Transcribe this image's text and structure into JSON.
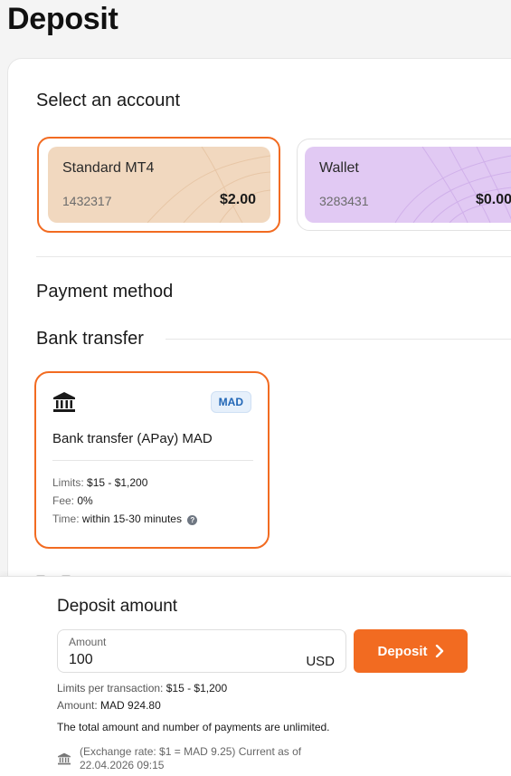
{
  "page": {
    "title": "Deposit"
  },
  "accounts_section": {
    "title": "Select an account",
    "accounts": [
      {
        "name": "Standard MT4",
        "number": "1432317",
        "balance": "$2.00",
        "selected": true,
        "color": "#f1d8bf"
      },
      {
        "name": "Wallet",
        "number": "3283431",
        "balance": "$0.00",
        "selected": false,
        "color": "#e1c9f3"
      }
    ]
  },
  "payment": {
    "title": "Payment method",
    "group_title": "Bank transfer",
    "method": {
      "icon": "bank-icon",
      "currency": "MAD",
      "name": "Bank transfer (APay) MAD",
      "limits_label": "Limits:",
      "limits_value": "$15 - $1,200",
      "fee_label": "Fee:",
      "fee_value": "0%",
      "time_label": "Time:",
      "time_value": "within 15-30 minutes"
    }
  },
  "deposit_amount": {
    "title": "Deposit amount",
    "field_label": "Amount",
    "value": "100",
    "currency": "USD",
    "button_label": "Deposit",
    "limits_label": "Limits per transaction:",
    "limits_value": "$15 - $1,200",
    "amount_label": "Amount:",
    "amount_value": "MAD 924.80",
    "note": "The total amount and number of payments are unlimited.",
    "rate_text": "(Exchange rate: $1 = MAD 9.25) Current as of 22.04.2026 09:15"
  },
  "colors": {
    "accent": "#f26b21",
    "badge_bg": "#e6f0fb",
    "badge_text": "#2166b6"
  }
}
